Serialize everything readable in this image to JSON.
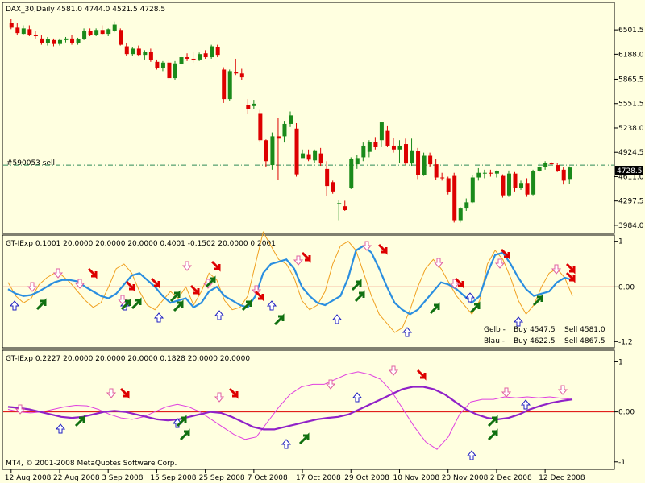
{
  "colors": {
    "background": "#ffffe0",
    "bull_candle": "#1a8a1a",
    "bear_candle": "#dd0000",
    "order_line": "#2e8b57",
    "indicator_blue": "#2a8ee0",
    "indicator_orange": "#f0a020",
    "indicator_purple": "#9022c8",
    "indicator_magenta": "#e040e0",
    "zero_line": "#dd0000",
    "buy_arrow": "#107010",
    "sell_arrow": "#dd0000",
    "hollow_up_arrow": "#2020c0",
    "hollow_down_arrow": "#e060a0"
  },
  "main": {
    "header": "DAX_30,Daily   4581.0 4744.0 4521.5 4728.5",
    "order_label": "#590053 sell",
    "current_price_label": "4728.5"
  },
  "panel1": {
    "header": "GT-IExp 0.1001 20.0000 20.0000 20.0000 0.4001 -0.1502 20.0000 0.2001",
    "legend": [
      {
        "label": "Gelb -",
        "buy": "Buy 4547.5",
        "sell": "Sell 4581.0",
        "color": "#f0a020"
      },
      {
        "label": "Blau -",
        "buy": "Buy 4622.5",
        "sell": "Sell 4867.5",
        "color": "#2a8ee0"
      }
    ]
  },
  "panel2": {
    "header": "GT-IExp 0.2227 20.0000 20.0000 20.0000 0.1828 20.0000 20.0000"
  },
  "footer": "MT4, © 2001-2008 MetaQuotes Software Corp.",
  "chart_data": [
    {
      "type": "candlestick",
      "title": "DAX_30,Daily",
      "ylim": [
        3900,
        6700
      ],
      "y_ticks": [
        {
          "value": 6501.5,
          "label": "6501.5"
        },
        {
          "value": 6188.0,
          "label": "6188.0"
        },
        {
          "value": 5865.5,
          "label": "5865.5"
        },
        {
          "value": 5551.5,
          "label": "5551.5"
        },
        {
          "value": 5238.0,
          "label": "5238.0"
        },
        {
          "value": 4924.5,
          "label": "4924.5"
        },
        {
          "value": 4611.0,
          "label": "4611.0"
        },
        {
          "value": 4297.5,
          "label": "4297.5"
        },
        {
          "value": 3984.0,
          "label": "3984.0"
        }
      ],
      "x_ticks": [
        "12 Aug 2008",
        "22 Aug 2008",
        "3 Sep 2008",
        "15 Sep 2008",
        "25 Sep 2008",
        "7 Oct 2008",
        "17 Oct 2008",
        "29 Oct 2008",
        "10 Nov 2008",
        "20 Nov 2008",
        "2 Dec 2008",
        "12 Dec 2008"
      ],
      "order_level": 4760,
      "last_price": 4728.5,
      "ohlc": [
        [
          6590,
          6640,
          6510,
          6530
        ],
        [
          6530,
          6590,
          6430,
          6460
        ],
        [
          6450,
          6560,
          6440,
          6520
        ],
        [
          6510,
          6560,
          6420,
          6440
        ],
        [
          6440,
          6490,
          6390,
          6420
        ],
        [
          6390,
          6430,
          6310,
          6330
        ],
        [
          6330,
          6410,
          6300,
          6380
        ],
        [
          6370,
          6390,
          6290,
          6320
        ],
        [
          6320,
          6390,
          6300,
          6370
        ],
        [
          6370,
          6410,
          6340,
          6390
        ],
        [
          6390,
          6440,
          6310,
          6330
        ],
        [
          6330,
          6400,
          6310,
          6380
        ],
        [
          6380,
          6520,
          6370,
          6490
        ],
        [
          6490,
          6520,
          6420,
          6440
        ],
        [
          6440,
          6520,
          6420,
          6500
        ],
        [
          6500,
          6560,
          6430,
          6450
        ],
        [
          6450,
          6520,
          6420,
          6510
        ],
        [
          6490,
          6610,
          6470,
          6570
        ],
        [
          6500,
          6520,
          6300,
          6310
        ],
        [
          6290,
          6330,
          6170,
          6190
        ],
        [
          6190,
          6280,
          6170,
          6260
        ],
        [
          6260,
          6300,
          6160,
          6180
        ],
        [
          6180,
          6240,
          6120,
          6220
        ],
        [
          6220,
          6260,
          6090,
          6110
        ],
        [
          6090,
          6120,
          5990,
          6010
        ],
        [
          6010,
          6100,
          5970,
          6080
        ],
        [
          6080,
          6120,
          5860,
          5880
        ],
        [
          5880,
          6100,
          5860,
          6070
        ],
        [
          6060,
          6180,
          6040,
          6150
        ],
        [
          6150,
          6200,
          6100,
          6130
        ],
        [
          6130,
          6220,
          6080,
          6120
        ],
        [
          6120,
          6210,
          6100,
          6190
        ],
        [
          6200,
          6240,
          6130,
          6150
        ],
        [
          6150,
          6310,
          6130,
          6290
        ],
        [
          6280,
          6310,
          6150,
          6180
        ],
        [
          5990,
          6020,
          5560,
          5610
        ],
        [
          5610,
          5990,
          5590,
          5970
        ],
        [
          5960,
          6130,
          5920,
          5940
        ],
        [
          5940,
          6000,
          5860,
          5890
        ],
        [
          5530,
          5610,
          5420,
          5480
        ],
        [
          5520,
          5600,
          5480,
          5550
        ],
        [
          5430,
          5470,
          5060,
          5080
        ],
        [
          5080,
          5090,
          4730,
          4810
        ],
        [
          4760,
          5180,
          4700,
          5130
        ],
        [
          5130,
          5370,
          4570,
          5100
        ],
        [
          5130,
          5330,
          5050,
          5290
        ],
        [
          5290,
          5450,
          5250,
          5400
        ],
        [
          5230,
          5300,
          4610,
          4640
        ],
        [
          4850,
          4960,
          4900,
          4910
        ],
        [
          4900,
          4960,
          4810,
          4830
        ],
        [
          4820,
          4960,
          4790,
          4950
        ],
        [
          4910,
          4980,
          4750,
          4780
        ],
        [
          4710,
          4810,
          4360,
          4490
        ],
        [
          4540,
          4560,
          4390,
          4420
        ],
        [
          4270,
          4310,
          4050,
          4270
        ],
        [
          4230,
          4300,
          4170,
          4180
        ],
        [
          4460,
          4860,
          4450,
          4840
        ],
        [
          4770,
          4890,
          4710,
          4850
        ],
        [
          4860,
          5050,
          4810,
          5010
        ],
        [
          4930,
          5080,
          4860,
          5060
        ],
        [
          5060,
          5120,
          4960,
          4990
        ],
        [
          5080,
          5310,
          5000,
          5310
        ],
        [
          5200,
          5270,
          4990,
          5010
        ],
        [
          5010,
          5110,
          4920,
          4960
        ],
        [
          4960,
          5080,
          4790,
          5010
        ],
        [
          5030,
          5100,
          4760,
          4780
        ],
        [
          4780,
          5100,
          4750,
          4950
        ],
        [
          4940,
          4980,
          4580,
          4630
        ],
        [
          4630,
          4920,
          4620,
          4880
        ],
        [
          4880,
          4920,
          4740,
          4770
        ],
        [
          4770,
          4840,
          4570,
          4600
        ],
        [
          4600,
          4660,
          4560,
          4590
        ],
        [
          4590,
          4610,
          4380,
          4410
        ],
        [
          4620,
          4660,
          4020,
          4050
        ],
        [
          4050,
          4220,
          4020,
          4200
        ],
        [
          4200,
          4330,
          4170,
          4280
        ],
        [
          4280,
          4630,
          4270,
          4600
        ],
        [
          4600,
          4720,
          4560,
          4660
        ],
        [
          4660,
          4700,
          4590,
          4660
        ],
        [
          4660,
          4700,
          4610,
          4650
        ],
        [
          4650,
          4690,
          4600,
          4680
        ],
        [
          4620,
          4640,
          4340,
          4370
        ],
        [
          4370,
          4690,
          4350,
          4650
        ],
        [
          4650,
          4670,
          4420,
          4470
        ],
        [
          4470,
          4560,
          4440,
          4530
        ],
        [
          4530,
          4590,
          4350,
          4380
        ],
        [
          4380,
          4700,
          4370,
          4680
        ],
        [
          4680,
          4790,
          4670,
          4730
        ],
        [
          4730,
          4810,
          4700,
          4790
        ],
        [
          4790,
          4800,
          4760,
          4770
        ],
        [
          4760,
          4790,
          4670,
          4680
        ],
        [
          4700,
          4740,
          4510,
          4560
        ],
        [
          4581,
          4744,
          4521.5,
          4728.5
        ]
      ]
    },
    {
      "type": "line",
      "title": "GT-IExp 0.1001 20.0000 20.0000 20.0000 0.4001 -0.1502 20.0000 0.2001",
      "ylim": [
        -1.3,
        1.1
      ],
      "y_ticks": [
        {
          "value": 1,
          "label": "1"
        },
        {
          "value": 0,
          "label": "0.00"
        },
        {
          "value": -1.2,
          "label": "-1.2"
        }
      ],
      "series": [
        {
          "name": "Blau",
          "color": "#2a8ee0",
          "values": [
            -0.05,
            -0.15,
            -0.2,
            -0.18,
            -0.1,
            0.0,
            0.1,
            0.15,
            0.15,
            0.12,
            0.0,
            -0.1,
            -0.2,
            -0.25,
            -0.15,
            0.05,
            0.25,
            0.3,
            0.15,
            0.0,
            -0.2,
            -0.35,
            -0.3,
            -0.25,
            -0.45,
            -0.35,
            -0.1,
            0.0,
            -0.2,
            -0.3,
            -0.4,
            -0.45,
            -0.2,
            0.3,
            0.5,
            0.55,
            0.6,
            0.4,
            0.0,
            -0.2,
            -0.35,
            -0.4,
            -0.3,
            -0.2,
            0.2,
            0.8,
            0.9,
            0.75,
            0.4,
            0.0,
            -0.35,
            -0.5,
            -0.6,
            -0.5,
            -0.3,
            -0.1,
            0.1,
            0.05,
            -0.05,
            -0.2,
            -0.35,
            -0.2,
            0.3,
            0.7,
            0.75,
            0.5,
            0.2,
            -0.05,
            -0.2,
            -0.15,
            -0.1,
            0.1,
            0.2,
            0.15
          ]
        },
        {
          "name": "Gelb",
          "color": "#f0a020",
          "values": [
            0.1,
            -0.2,
            -0.35,
            -0.25,
            0.05,
            0.2,
            0.3,
            0.25,
            0.1,
            -0.1,
            -0.3,
            -0.45,
            -0.35,
            0.0,
            0.4,
            0.5,
            0.3,
            -0.1,
            -0.4,
            -0.5,
            -0.3,
            -0.1,
            -0.25,
            0.0,
            -0.4,
            -0.1,
            0.3,
            0.15,
            -0.3,
            -0.5,
            -0.45,
            -0.2,
            0.5,
            1.2,
            0.9,
            0.6,
            0.5,
            0.2,
            -0.3,
            -0.5,
            -0.4,
            -0.1,
            0.5,
            0.9,
            1.0,
            0.8,
            0.3,
            -0.2,
            -0.6,
            -0.8,
            -1.0,
            -0.9,
            -0.5,
            0.0,
            0.4,
            0.6,
            0.4,
            0.1,
            -0.2,
            -0.4,
            -0.6,
            -0.3,
            0.5,
            0.8,
            0.6,
            0.2,
            -0.3,
            -0.6,
            -0.4,
            0.0,
            0.3,
            0.4,
            0.2,
            -0.2
          ]
        }
      ]
    },
    {
      "type": "line",
      "title": "GT-IExp 0.2227 20.0000 20.0000 20.0000 0.1828 20.0000 20.0000",
      "ylim": [
        -1.1,
        1.2
      ],
      "y_ticks": [
        {
          "value": 1,
          "label": "1"
        },
        {
          "value": 0,
          "label": "0.00"
        },
        {
          "value": -1,
          "label": "-1"
        }
      ],
      "series": [
        {
          "name": "",
          "color": "#9022c8",
          "values": [
            0.1,
            0.08,
            0.05,
            0.0,
            -0.05,
            -0.1,
            -0.12,
            -0.1,
            -0.05,
            0.0,
            0.02,
            0.0,
            -0.05,
            -0.1,
            -0.15,
            -0.17,
            -0.15,
            -0.1,
            -0.05,
            0.0,
            -0.02,
            -0.1,
            -0.2,
            -0.3,
            -0.35,
            -0.35,
            -0.3,
            -0.25,
            -0.2,
            -0.15,
            -0.12,
            -0.1,
            -0.05,
            0.05,
            0.15,
            0.25,
            0.35,
            0.45,
            0.5,
            0.5,
            0.45,
            0.35,
            0.2,
            0.05,
            -0.05,
            -0.12,
            -0.15,
            -0.12,
            -0.05,
            0.05,
            0.12,
            0.18,
            0.22,
            0.25
          ]
        },
        {
          "name": "",
          "color": "#e040e0",
          "values": [
            0.05,
            0.0,
            -0.02,
            0.0,
            0.05,
            0.1,
            0.13,
            0.12,
            0.05,
            -0.05,
            -0.12,
            -0.15,
            -0.1,
            0.0,
            0.1,
            0.15,
            0.1,
            0.0,
            -0.15,
            -0.3,
            -0.45,
            -0.55,
            -0.5,
            -0.2,
            0.1,
            0.35,
            0.5,
            0.55,
            0.55,
            0.65,
            0.75,
            0.8,
            0.75,
            0.65,
            0.4,
            0.05,
            -0.3,
            -0.6,
            -0.75,
            -0.5,
            -0.05,
            0.2,
            0.25,
            0.25,
            0.3,
            0.28,
            0.3,
            0.28,
            0.3,
            0.27,
            0.25
          ]
        }
      ]
    }
  ]
}
